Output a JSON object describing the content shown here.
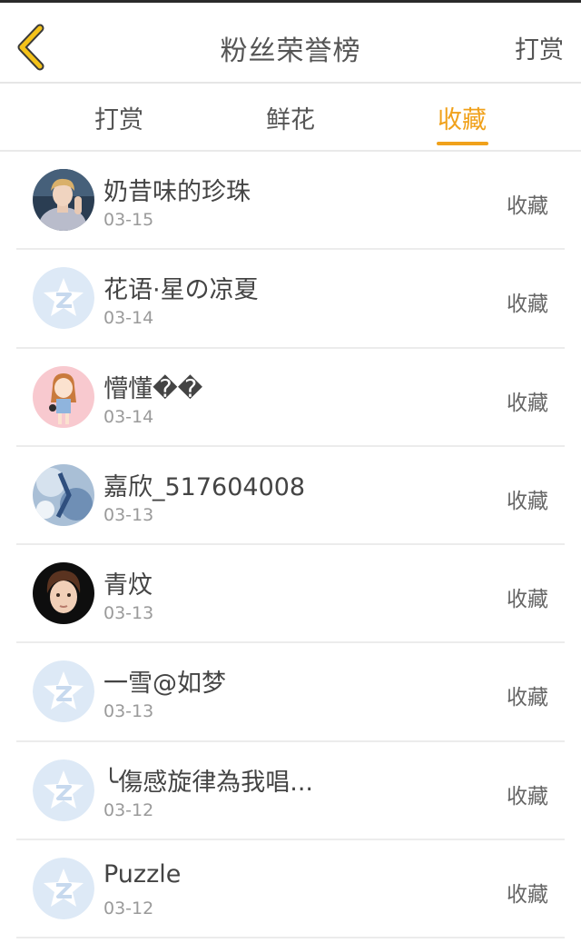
{
  "header": {
    "title": "粉丝荣誉榜",
    "action": "打赏",
    "accent": "#f0a11b"
  },
  "tabs": [
    {
      "label": "打赏",
      "active": false
    },
    {
      "label": "鲜花",
      "active": false
    },
    {
      "label": "收藏",
      "active": true
    }
  ],
  "list": [
    {
      "name": "奶昔味的珍珠",
      "date": "03-15",
      "action": "收藏",
      "avatar": "photo-boy-icon"
    },
    {
      "name": "花语·星の凉夏",
      "date": "03-14",
      "action": "收藏",
      "avatar": "default-qzone-icon"
    },
    {
      "name": "懵懂��",
      "date": "03-14",
      "action": "收藏",
      "avatar": "cartoon-girl-icon"
    },
    {
      "name": "嘉欣_517604008",
      "date": "03-13",
      "action": "收藏",
      "avatar": "photo-blue-icon"
    },
    {
      "name": "青炆",
      "date": "03-13",
      "action": "收藏",
      "avatar": "cartoon-boy-icon"
    },
    {
      "name": "一雪@如梦",
      "date": "03-13",
      "action": "收藏",
      "avatar": "default-qzone-icon"
    },
    {
      "name": "╰傷感旋律為我唱...",
      "date": "03-12",
      "action": "收藏",
      "avatar": "default-qzone-icon"
    },
    {
      "name": "Puzzle",
      "date": "03-12",
      "action": "收藏",
      "avatar": "default-qzone-icon"
    }
  ]
}
